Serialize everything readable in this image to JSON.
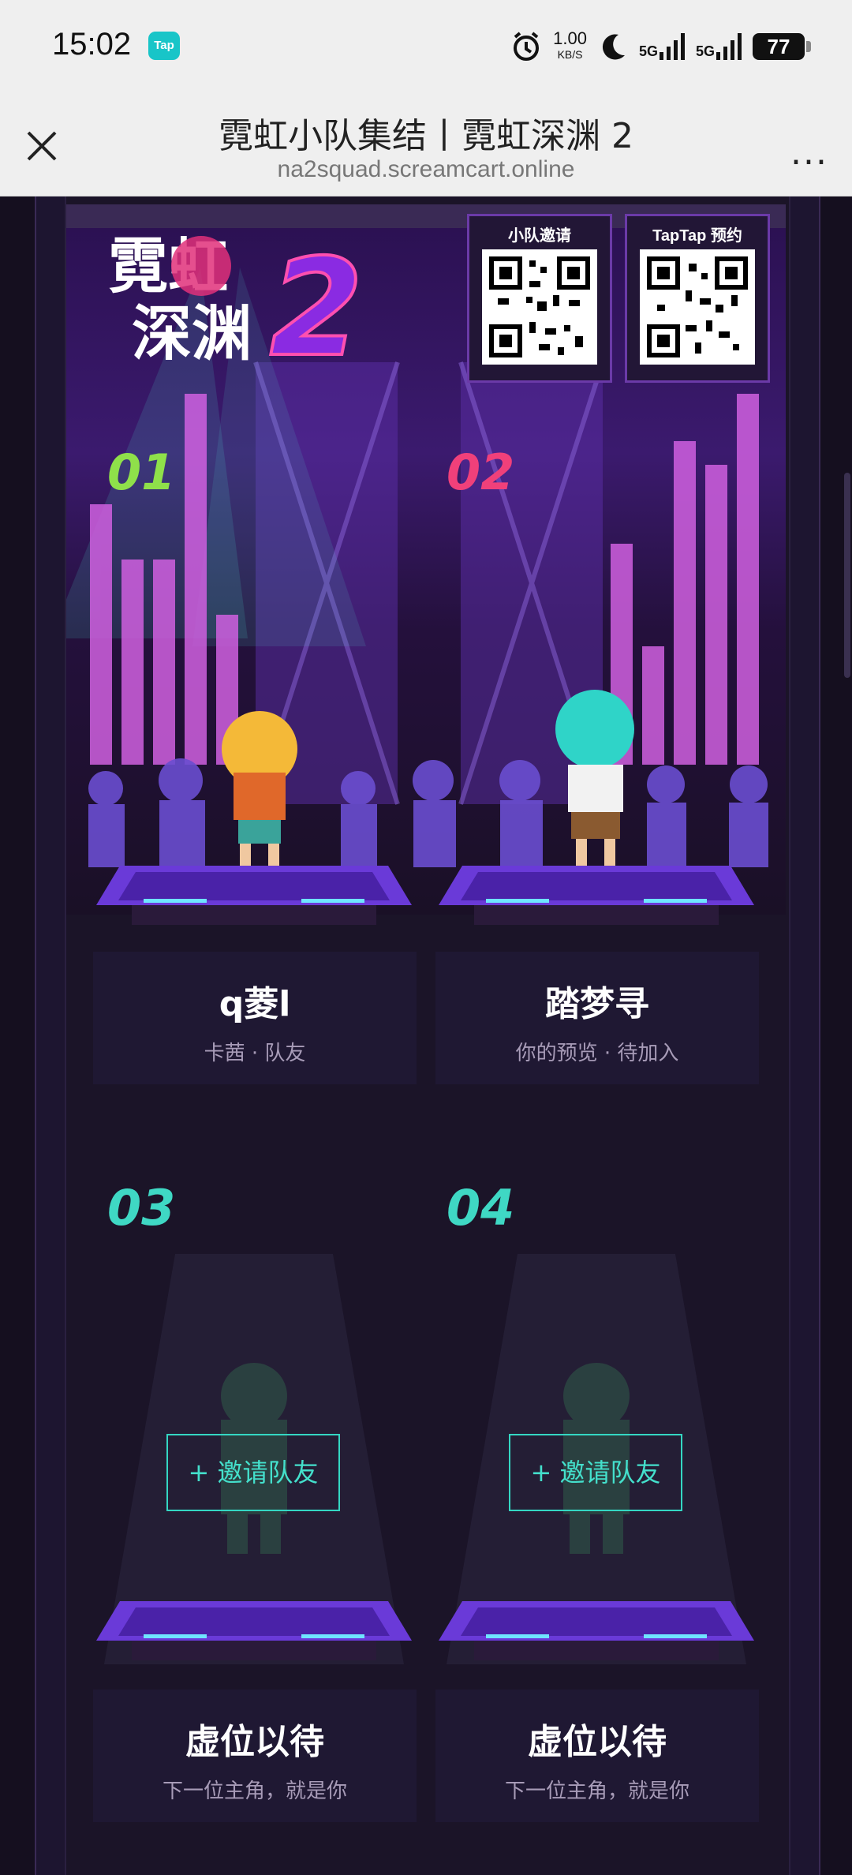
{
  "status_bar": {
    "time": "15:02",
    "app_badge": "Tap",
    "net_speed": "1.00",
    "net_unit": "KB/S",
    "signal1": "5G",
    "signal2": "5G",
    "battery": "77"
  },
  "titlebar": {
    "title": "霓虹小队集结丨霓虹深渊 2",
    "url": "na2squad.screamcart.online",
    "more": "..."
  },
  "qr_codes": [
    {
      "label": "小队邀请"
    },
    {
      "label": "TapTap 预约"
    }
  ],
  "logo": {
    "line1": "霓虹",
    "line2": "深渊",
    "number": "2"
  },
  "slots": [
    {
      "number": "01",
      "number_color": "#8fe04a",
      "name": "q菱l",
      "sub": "卡茜 · 队友"
    },
    {
      "number": "02",
      "number_color": "#f0407a",
      "name": "踏梦寻",
      "sub": "你的预览 · 待加入"
    },
    {
      "number": "03",
      "number_color": "#3fd8c4",
      "name": "虚位以待",
      "sub": "下一位主角，就是你",
      "invite": "邀请队友"
    },
    {
      "number": "04",
      "number_color": "#3fd8c4",
      "name": "虚位以待",
      "sub": "下一位主角，就是你",
      "invite": "邀请队友"
    }
  ],
  "colors": {
    "accent_teal": "#34d7c3",
    "accent_purple": "#7a3ad0"
  }
}
